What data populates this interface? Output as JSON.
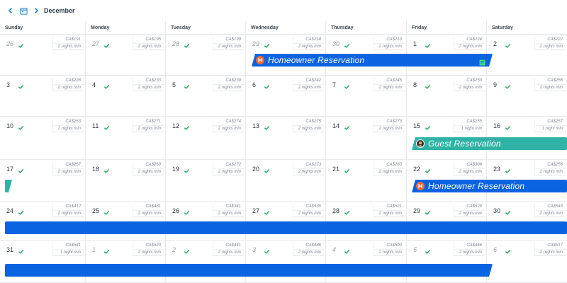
{
  "header": {
    "month": "December",
    "prev_icon": "chevron-left-icon",
    "calendar_icon": "calendar-icon",
    "next_icon": "chevron-right-icon"
  },
  "weekdays": [
    "Sunday",
    "Monday",
    "Tuesday",
    "Wednesday",
    "Thursday",
    "Friday",
    "Saturday"
  ],
  "weeks": [
    [
      {
        "day": "26",
        "muted": true,
        "code": "CA$191",
        "min": "2 nights  min"
      },
      {
        "day": "27",
        "muted": true,
        "code": "CA$195",
        "min": "2 nights  min"
      },
      {
        "day": "28",
        "muted": true,
        "code": "CA$199",
        "min": "2 nights  min"
      },
      {
        "day": "29",
        "muted": true,
        "code": "CA$214",
        "min": "2 nights  min"
      },
      {
        "day": "30",
        "muted": true,
        "code": "CA$210",
        "min": "2 nights  min"
      },
      {
        "day": "1",
        "muted": false,
        "code": "CA$224",
        "min": "2 nights  min"
      },
      {
        "day": "2",
        "muted": false,
        "code": "CA$222",
        "min": "2 nights  min"
      }
    ],
    [
      {
        "day": "3",
        "muted": false,
        "code": "CA$228",
        "min": "2 nights  min"
      },
      {
        "day": "4",
        "muted": false,
        "code": "CA$233",
        "min": "2 nights  min"
      },
      {
        "day": "5",
        "muted": false,
        "code": "CA$239",
        "min": "2 nights  min"
      },
      {
        "day": "6",
        "muted": false,
        "code": "CA$242",
        "min": "2 nights  min"
      },
      {
        "day": "7",
        "muted": false,
        "code": "CA$245",
        "min": "2 nights  min"
      },
      {
        "day": "8",
        "muted": false,
        "code": "CA$250",
        "min": "2 nights  min"
      },
      {
        "day": "9",
        "muted": false,
        "code": "CA$256",
        "min": "2 nights  min"
      }
    ],
    [
      {
        "day": "10",
        "muted": false,
        "code": "CA$263",
        "min": "2 nights  min"
      },
      {
        "day": "11",
        "muted": false,
        "code": "CA$271",
        "min": "2 nights  min"
      },
      {
        "day": "12",
        "muted": false,
        "code": "CA$274",
        "min": "2 nights  min"
      },
      {
        "day": "13",
        "muted": false,
        "code": "CA$275",
        "min": "2 nights  min"
      },
      {
        "day": "14",
        "muted": false,
        "code": "CA$273",
        "min": "2 nights  min"
      },
      {
        "day": "15",
        "muted": false,
        "code": "CA$255",
        "min": "1 night  min"
      },
      {
        "day": "16",
        "muted": false,
        "code": "CA$257",
        "min": "1 night  min"
      }
    ],
    [
      {
        "day": "17",
        "muted": false,
        "code": "CA$267",
        "min": "2 nights  min"
      },
      {
        "day": "18",
        "muted": false,
        "code": "CA$269",
        "min": "2 nights  min"
      },
      {
        "day": "19",
        "muted": false,
        "code": "CA$272",
        "min": "2 nights  min"
      },
      {
        "day": "20",
        "muted": false,
        "code": "CA$273",
        "min": "2 nights  min"
      },
      {
        "day": "21",
        "muted": false,
        "code": "CA$283",
        "min": "2 nights  min"
      },
      {
        "day": "22",
        "muted": false,
        "code": "CA$306",
        "min": "2 nights  min"
      },
      {
        "day": "23",
        "muted": false,
        "code": "CA$256",
        "min": "2 nights  min"
      }
    ],
    [
      {
        "day": "24",
        "muted": false,
        "code": "CA$412",
        "min": "2 nights  min"
      },
      {
        "day": "25",
        "muted": false,
        "code": "CA$481",
        "min": "2 nights  min"
      },
      {
        "day": "26",
        "muted": false,
        "code": "CA$341",
        "min": "2 nights  min"
      },
      {
        "day": "27",
        "muted": false,
        "code": "CA$535",
        "min": "2 nights  min"
      },
      {
        "day": "28",
        "muted": false,
        "code": "CA$521",
        "min": "2 nights  min"
      },
      {
        "day": "29",
        "muted": false,
        "code": "CA$529",
        "min": "2 nights  min"
      },
      {
        "day": "30",
        "muted": false,
        "code": "CA$543",
        "min": "2 nights  min"
      }
    ],
    [
      {
        "day": "31",
        "muted": false,
        "code": "CA$541",
        "min": "1 night  min"
      },
      {
        "day": "1",
        "muted": true,
        "code": "CA$523",
        "min": "2 nights  min"
      },
      {
        "day": "2",
        "muted": true,
        "code": "CA$441",
        "min": "2 nights  min"
      },
      {
        "day": "3",
        "muted": true,
        "code": "CA$486",
        "min": "2 nights  min"
      },
      {
        "day": "4",
        "muted": true,
        "code": "CA$500",
        "min": "2 nights  min"
      },
      {
        "day": "5",
        "muted": true,
        "code": "CA$466",
        "min": "2 nights  min"
      },
      {
        "day": "6",
        "muted": true,
        "code": "CA$517",
        "min": "2 nights  min"
      }
    ]
  ],
  "reservations": [
    {
      "label": "Homeowner Reservation",
      "kind": "owner",
      "badge": "homeowner-icon",
      "color": "#0a63e0"
    },
    {
      "label": "Guest  Reservation",
      "kind": "guest",
      "badge": "guest-avatar",
      "color": "#2fb3a6"
    },
    {
      "label": "Homeowner Reservation",
      "kind": "owner",
      "badge": "homeowner-icon",
      "color": "#0a63e0"
    },
    {
      "label": "",
      "kind": "owner",
      "color": "#0a63e0"
    },
    {
      "label": "",
      "kind": "owner",
      "color": "#0a63e0"
    },
    {
      "label": "",
      "kind": "guest",
      "color": "#2fb3a6"
    }
  ],
  "colors": {
    "check_green": "#2eaa62",
    "owner_blue": "#0a63e0",
    "guest_teal": "#2fb3a6",
    "homeowner_badge": "#f06a3c"
  }
}
